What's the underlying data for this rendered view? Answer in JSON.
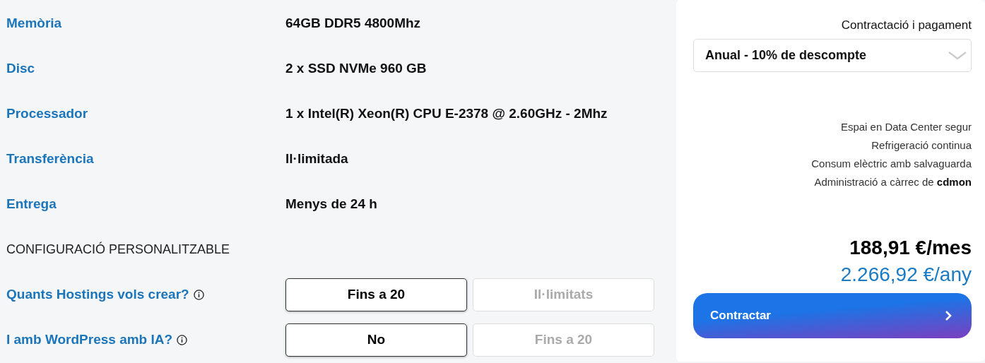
{
  "specs": [
    {
      "label": "Memòria",
      "value": "64GB DDR5 4800Mhz"
    },
    {
      "label": "Disc",
      "value": "2 x SSD NVMe 960 GB"
    },
    {
      "label": "Processador",
      "value": "1 x Intel(R) Xeon(R) CPU E-2378 @ 2.60GHz - 2Mhz"
    },
    {
      "label": "Transferència",
      "value": "Il·limitada"
    },
    {
      "label": "Entrega",
      "value": "Menys de 24 h"
    }
  ],
  "config_heading": "CONFIGURACIÓ PERSONALITZABLE",
  "options": [
    {
      "label": "Quants Hostings vols crear?",
      "choices": [
        {
          "label": "Fins a 20",
          "selected": true
        },
        {
          "label": "Il·limitats",
          "selected": false
        }
      ]
    },
    {
      "label": "I amb WordPress amb IA?",
      "choices": [
        {
          "label": "No",
          "selected": true
        },
        {
          "label": "Fins a 20",
          "selected": false
        }
      ]
    }
  ],
  "order": {
    "heading": "Contractació i pagament",
    "billing": "Anual - 10% de descompte",
    "features": [
      "Espai en Data Center segur",
      "Refrigeració continua",
      "Consum elèctric amb salvaguarda",
      "Administració a càrrec de **cdmon**"
    ],
    "monthly_price": "188,91 €/mes",
    "yearly_price": "2.266,92 €/any",
    "button": "Contractar"
  }
}
